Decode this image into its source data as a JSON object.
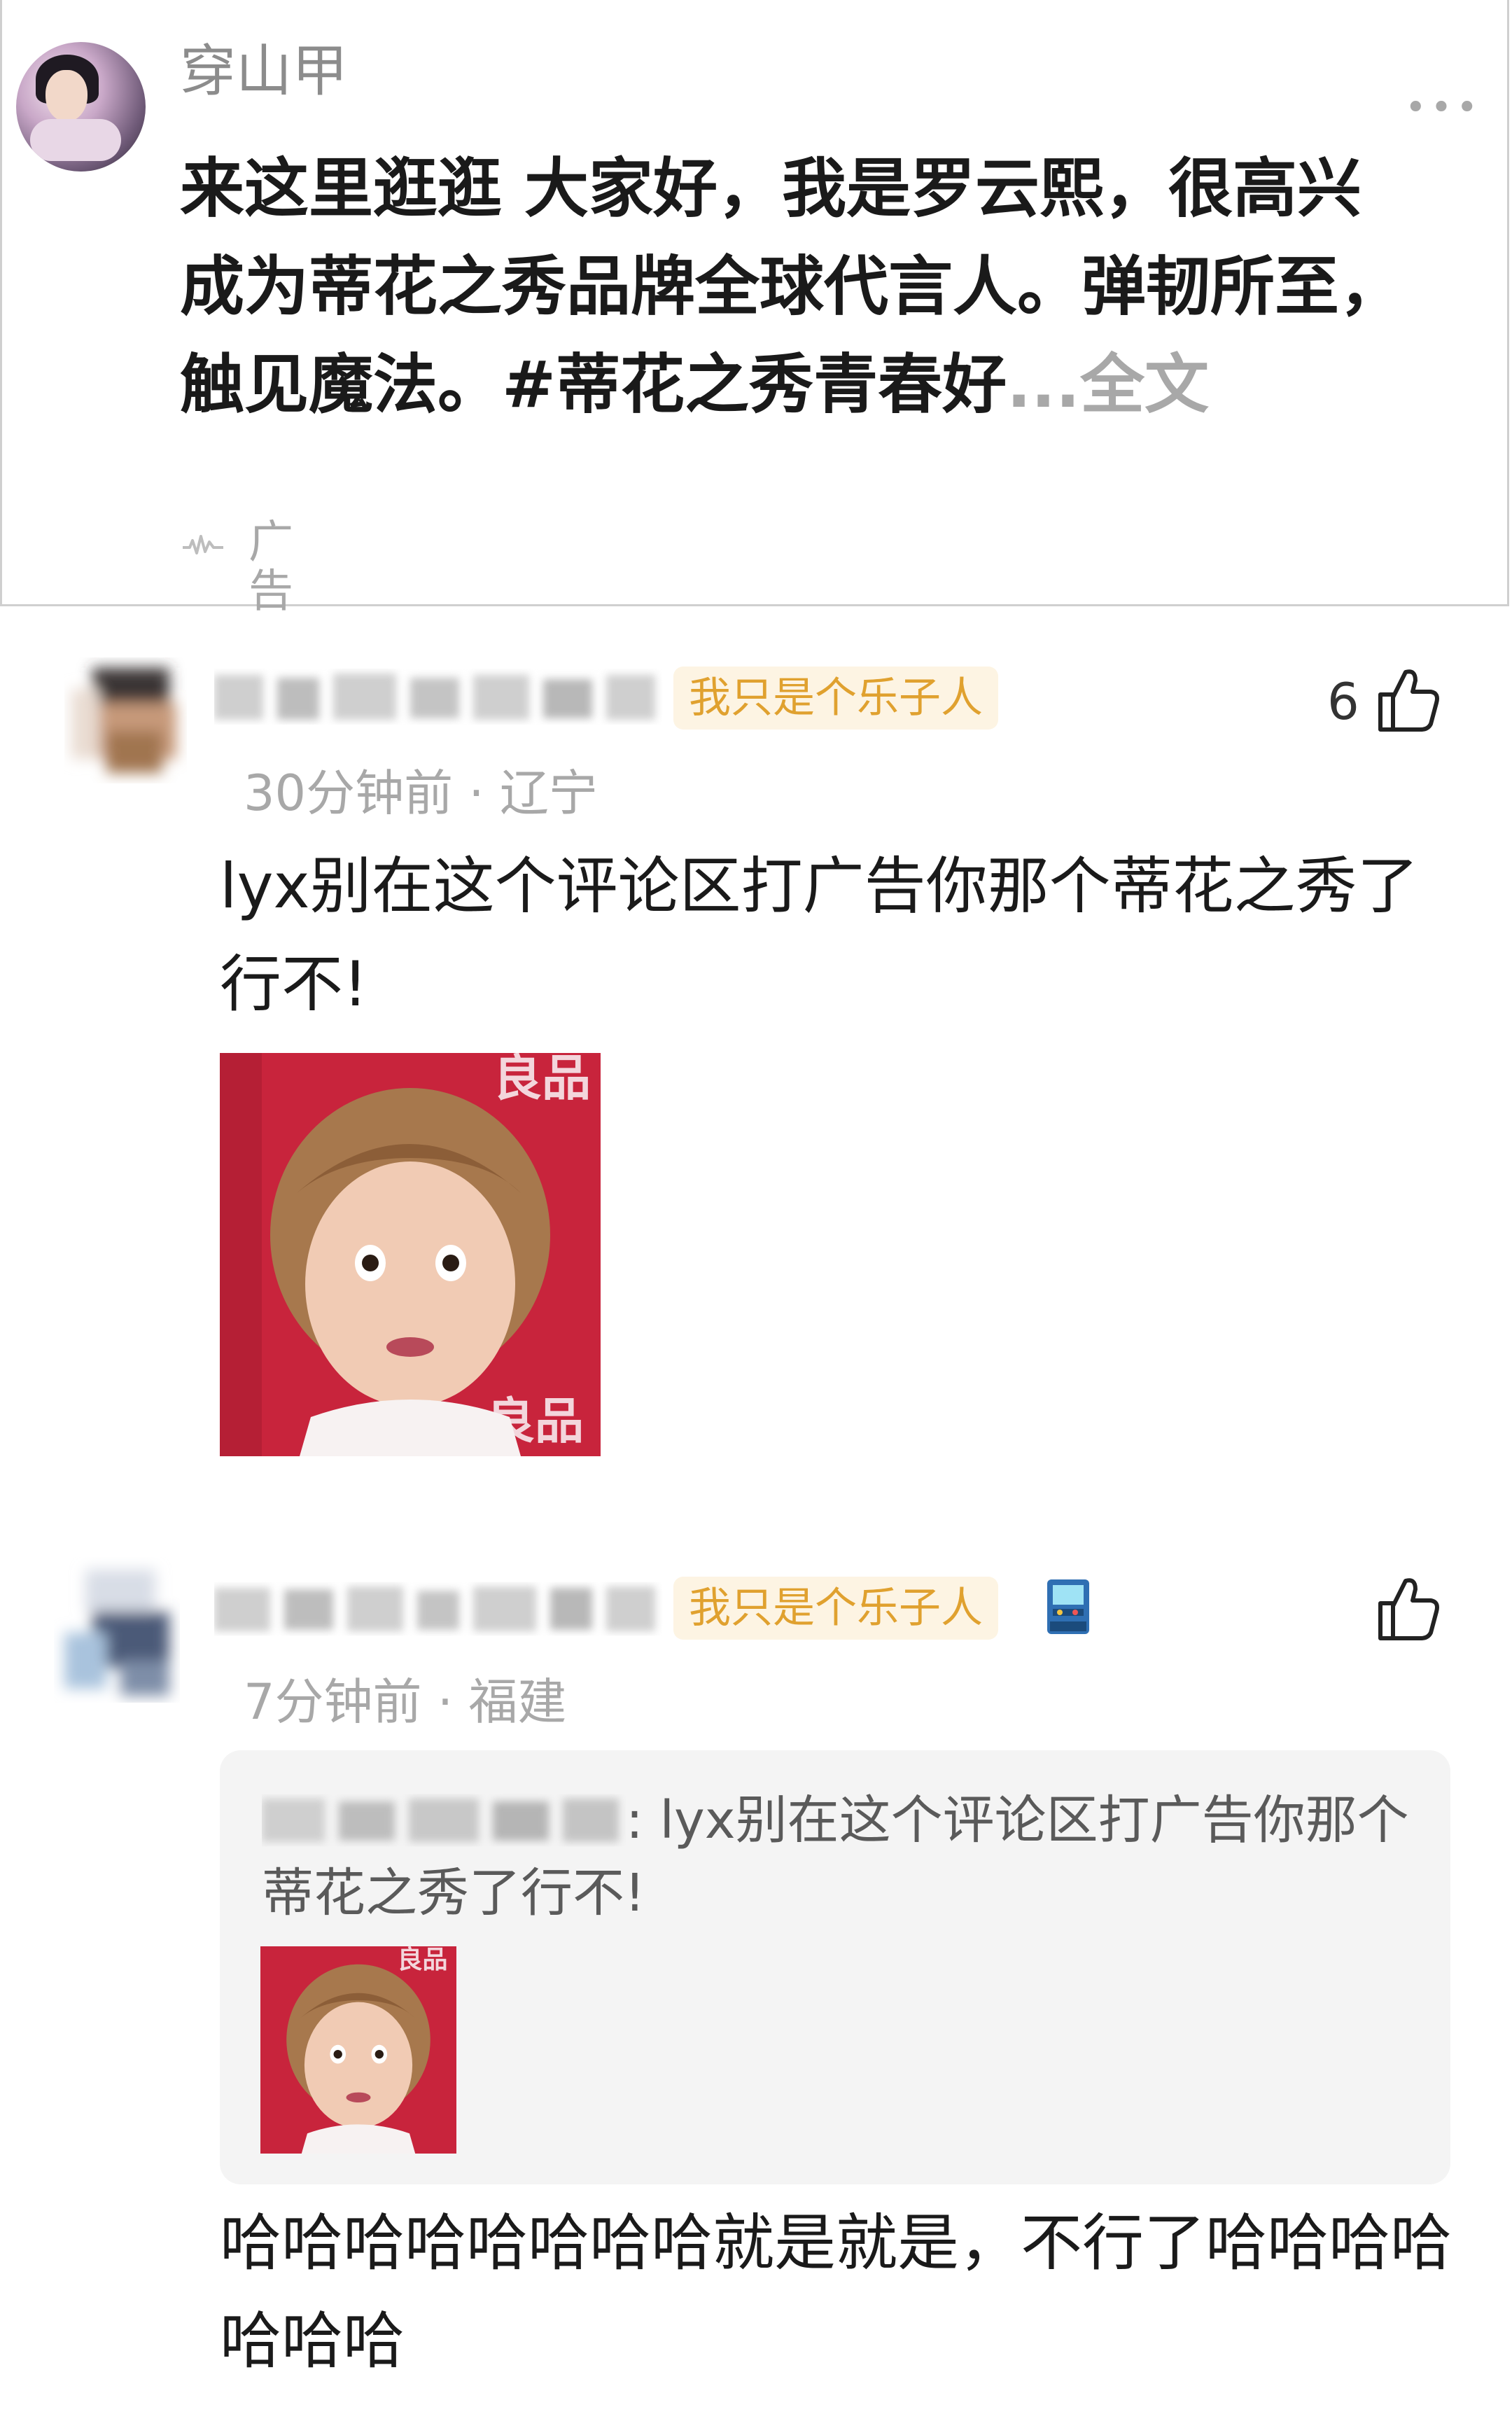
{
  "post": {
    "author": "穿山甲",
    "text": "来这里逛逛 大家好，我是罗云熙，很高兴成为蒂花之秀品牌全球代言人。弹韧所至，触见魔法。#蒂花之秀青春好",
    "fold_label": "...全文",
    "more_icon": "more-dots-icon",
    "ad_label": "广告"
  },
  "comments": [
    {
      "badge": "我只是个乐子人",
      "time": "30分钟前",
      "location": "辽宁",
      "meta_sep": "·",
      "likes": "6",
      "text": "lyx别在这个评论区打广告你那个蒂花之秀了行不!",
      "sticker": "surprised-face-sticker"
    },
    {
      "badge": "我只是个乐子人",
      "time": "7分钟前",
      "location": "福建",
      "meta_sep": "·",
      "likes": "",
      "quoted_text": ": lyx别在这个评论区打广告你那个蒂花之秀了行不!",
      "text": "哈哈哈哈哈哈哈哈就是就是，不行了哈哈哈哈哈哈哈",
      "sticker": "surprised-face-sticker"
    }
  ],
  "colors": {
    "badge_bg": "#fdf4e3",
    "badge_text": "#e0a12f",
    "sticker_red": "#c8243c",
    "meta_gray": "#a8a8a8"
  }
}
